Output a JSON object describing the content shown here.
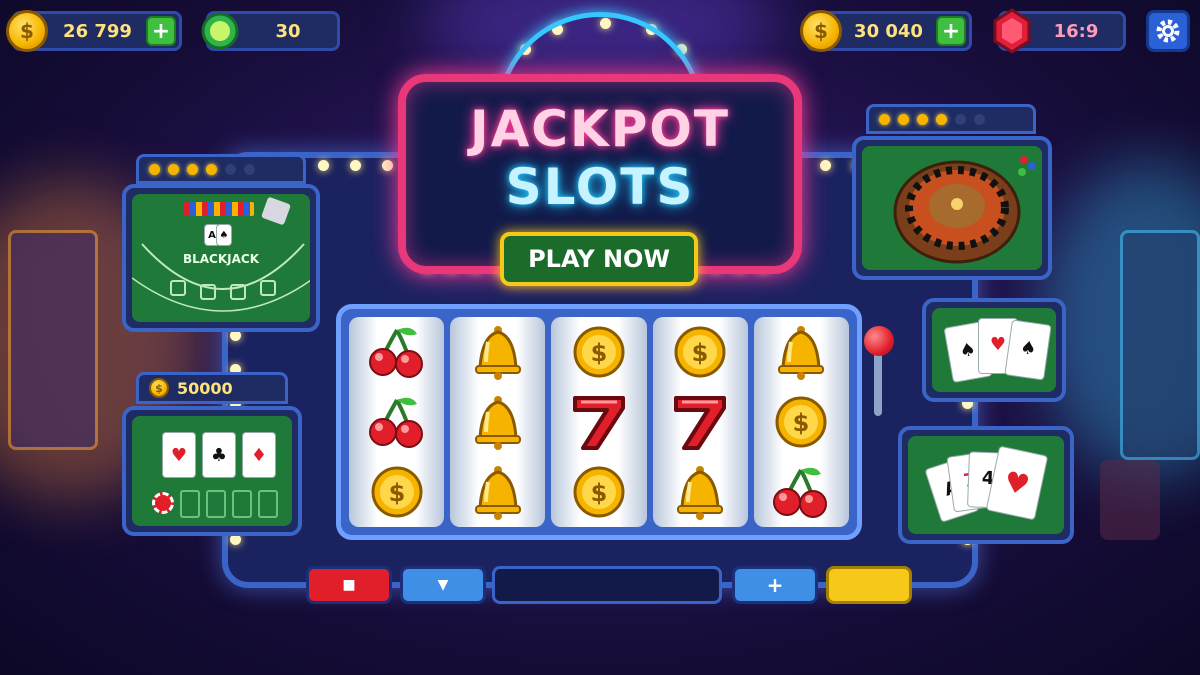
{
  "topbar": {
    "coins_left": "26 799",
    "gems_left": "30",
    "coins_right": "30 040",
    "ruby_value": "16:9",
    "plus_symbol": "+",
    "coin_symbol": "$"
  },
  "marquee": {
    "title_line1": "JACKPOT",
    "title_line2": "SLOTS",
    "play_button": "PLAY NOW"
  },
  "panels": {
    "blackjack_label": "BLACKJACK",
    "poker_bet": "50000",
    "card_ace": "A",
    "card_seven": "7",
    "card_four": "4",
    "card_five": "5"
  },
  "reels": [
    [
      "cherry",
      "cherry",
      "coin"
    ],
    [
      "bell",
      "bell",
      "bell"
    ],
    [
      "coin",
      "seven",
      "coin"
    ],
    [
      "coin",
      "seven",
      "bell"
    ],
    [
      "bell",
      "coin",
      "cherry"
    ]
  ],
  "controls": {
    "stop_symbol": "■",
    "down_symbol": "▼",
    "plus_symbol": "+"
  },
  "icons": {
    "settings": "gear-icon",
    "coin": "coin-icon",
    "gem": "gem-icon",
    "ruby": "ruby-icon"
  },
  "colors": {
    "neon_pink": "#ff3d9a",
    "neon_blue": "#21c7ff",
    "gold": "#f6b400",
    "felt_green": "#1f7a3a"
  }
}
